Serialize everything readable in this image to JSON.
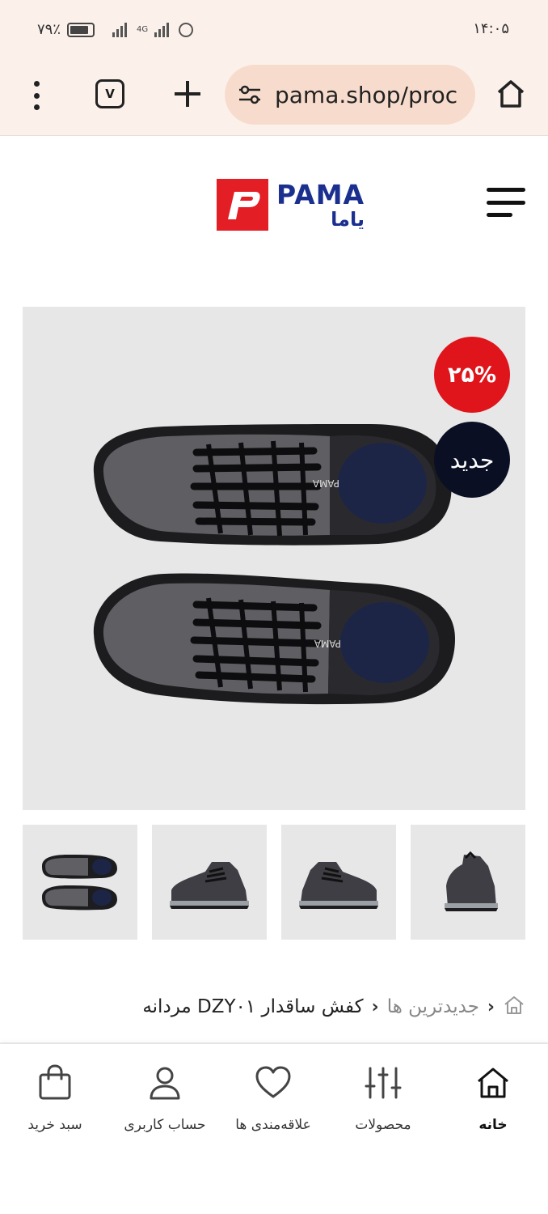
{
  "status_bar": {
    "battery_text": "۷۹٪",
    "network_label": "4G",
    "time": "۱۴:۰۵"
  },
  "browser": {
    "tab_count": "V",
    "url": "pama.shop/proc"
  },
  "site": {
    "logo_en": "PAMA",
    "logo_fa": "یاما",
    "brand_color": "#1b2f8f",
    "logo_red": "#e31e24"
  },
  "product": {
    "discount_badge": "۲۵%",
    "new_badge": "جدید",
    "badge_discount_color": "#e0141b",
    "badge_new_color": "#0a0f24",
    "thumbnails": [
      "top-view",
      "side-view-left",
      "side-view-right",
      "back-view"
    ]
  },
  "breadcrumb": {
    "category": "جدیدترین ها",
    "current": "کفش ساقدار DZY۰۱ مردانه",
    "separator": "›"
  },
  "bottom_nav": {
    "home": "خانه",
    "products": "محصولات",
    "wishlist": "علاقه‌مندی ها",
    "account": "حساب کاربری",
    "cart": "سبد خرید"
  }
}
